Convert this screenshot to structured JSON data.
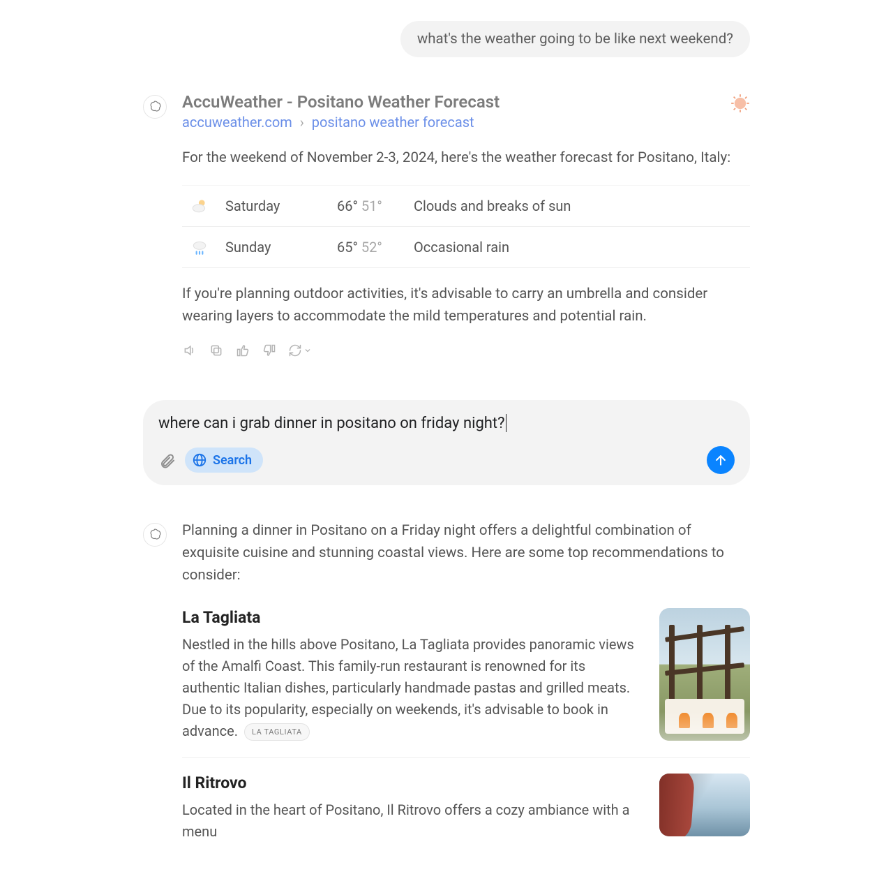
{
  "user_message": "what's the weather going to be like next weekend?",
  "source": {
    "title": "AccuWeather - Positano Weather Forecast",
    "domain": "accuweather.com",
    "page": "positano weather forecast"
  },
  "weather": {
    "intro": "For the weekend of November 2-3, 2024, here's the weather forecast for Positano, Italy:",
    "rows": [
      {
        "day": "Saturday",
        "high": "66°",
        "low": "51°",
        "desc": "Clouds and breaks of sun",
        "icon": "partly-cloudy"
      },
      {
        "day": "Sunday",
        "high": "65°",
        "low": "52°",
        "desc": "Occasional rain",
        "icon": "rain"
      }
    ],
    "advice": "If you're planning outdoor activities, it's advisable to carry an umbrella and consider wearing layers to accommodate the mild temperatures and potential rain."
  },
  "composer": {
    "text": "where can i grab dinner in positano on friday night?",
    "search_label": "Search"
  },
  "reco": {
    "intro": "Planning a dinner in Positano on a Friday night offers a delightful combination of exquisite cuisine and stunning coastal views. Here are some top recommendations to consider:",
    "items": [
      {
        "name": "La Tagliata",
        "desc": "Nestled in the hills above Positano, La Tagliata provides panoramic views of the Amalfi Coast. This family-run restaurant is renowned for its authentic Italian dishes, particularly handmade pastas and grilled meats. Due to its popularity, especially on weekends, it's advisable to book in advance.",
        "citation": "LA TAGLIATA"
      },
      {
        "name": "Il Ritrovo",
        "desc": "Located in the heart of Positano, Il Ritrovo offers a cozy ambiance with a menu",
        "citation": ""
      }
    ]
  }
}
